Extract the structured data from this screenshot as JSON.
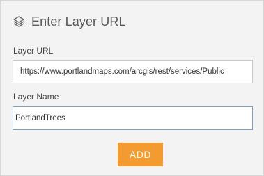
{
  "header": {
    "icon": "layers-icon",
    "title": "Enter Layer URL"
  },
  "form": {
    "url_label": "Layer URL",
    "url_value": "https://www.portlandmaps.com/arcgis/rest/services/Public",
    "name_label": "Layer Name",
    "name_value": "PortlandTrees",
    "add_label": "ADD"
  },
  "colors": {
    "panel_background": "#f3f3f3",
    "accent_button": "#f39a30",
    "focused_border": "#7e9fbf"
  }
}
